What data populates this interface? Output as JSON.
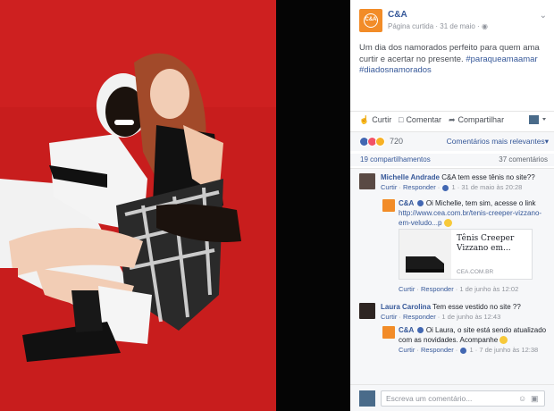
{
  "post": {
    "page_name": "C&A",
    "logo_text": "C&A",
    "subtitle": "Página curtida · 31 de maio ·",
    "text": "Um dia dos namorados perfeito para quem ama curtir e acertar no presente.",
    "hashtags": "#paraqueamaamar #diadosnamorados"
  },
  "actions": {
    "like": "Curtir",
    "comment": "Comentar",
    "share": "Compartilhar"
  },
  "reactions": {
    "count": "720",
    "relevant": "Comentários mais relevantes"
  },
  "stats": {
    "shares": "19 compartilhamentos",
    "comments": "37 comentários"
  },
  "comments": [
    {
      "name": "Michelle Andrade",
      "text": "C&A tem esse tênis no site??",
      "like": "Curtir",
      "reply": "Responder",
      "likes": "1",
      "time": "31 de maio às 20:28"
    },
    {
      "name": "C&A",
      "text": "Oi Michelle, tem sim, acesse o link",
      "link": "http://www.cea.com.br/tenis-creeper-vizzano-em-veludo...p",
      "preview_title": "Tênis Creeper Vizzano em...",
      "preview_domain": "CEA.COM.BR",
      "like": "Curtir",
      "reply": "Responder",
      "time": "1 de junho às 12:02"
    },
    {
      "name": "Laura Carolina",
      "text": "Tem esse vestido no site ??",
      "like": "Curtir",
      "reply": "Responder",
      "time": "1 de junho às 12:43"
    },
    {
      "name": "C&A",
      "text": "Oi Laura, o site está sendo atualizado com as novidades. Acompanhe",
      "like": "Curtir",
      "reply": "Responder",
      "likes": "1",
      "time": "7 de junho às 12:38"
    }
  ],
  "composer": {
    "placeholder": "Escreva um comentário..."
  },
  "colors": {
    "photo_background": "#c81d1d",
    "brand_orange": "#f28c28",
    "link_blue": "#365899"
  },
  "icons": [
    "globe-icon",
    "like-icon",
    "comment-icon",
    "share-icon",
    "camera-icon",
    "emoji-icon",
    "verified-icon",
    "chevron-down-icon"
  ]
}
